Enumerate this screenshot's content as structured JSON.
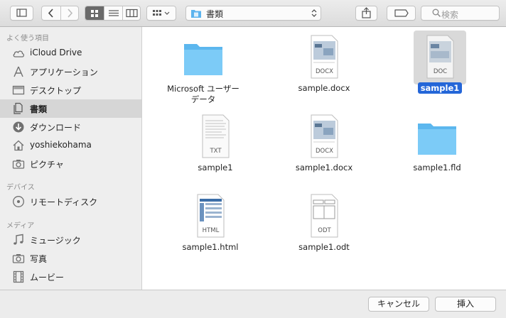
{
  "toolbar": {
    "path_label": "書類",
    "search_placeholder": "検索"
  },
  "sidebar": {
    "sections": [
      {
        "title": "よく使う項目"
      },
      {
        "title": "デバイス"
      },
      {
        "title": "メディア"
      }
    ],
    "items": [
      {
        "label": "iCloud Drive",
        "icon": "cloud-icon"
      },
      {
        "label": "アプリケーション",
        "icon": "applications-icon"
      },
      {
        "label": "デスクトップ",
        "icon": "desktop-icon"
      },
      {
        "label": "書類",
        "icon": "documents-icon",
        "active": true
      },
      {
        "label": "ダウンロード",
        "icon": "download-icon"
      },
      {
        "label": "yoshiekohama",
        "icon": "home-icon"
      },
      {
        "label": "ピクチャ",
        "icon": "camera-icon"
      },
      {
        "label": "リモートディスク",
        "icon": "disc-icon"
      },
      {
        "label": "ミュージック",
        "icon": "music-icon"
      },
      {
        "label": "写真",
        "icon": "camera-icon"
      },
      {
        "label": "ムービー",
        "icon": "film-icon"
      }
    ]
  },
  "files": [
    {
      "name": "Microsoft ユーザー\nデータ",
      "kind": "folder"
    },
    {
      "name": "sample.docx",
      "kind": "document",
      "badge": "DOCX"
    },
    {
      "name": "sample1",
      "kind": "document",
      "badge": "DOC",
      "selected": true
    },
    {
      "name": "sample1",
      "kind": "document",
      "badge": "TXT"
    },
    {
      "name": "sample1.docx",
      "kind": "document",
      "badge": "DOCX"
    },
    {
      "name": "sample1.fld",
      "kind": "folder"
    },
    {
      "name": "sample1.html",
      "kind": "document",
      "badge": "HTML"
    },
    {
      "name": "sample1.odt",
      "kind": "document",
      "badge": "ODT"
    }
  ],
  "buttons": {
    "cancel": "キャンセル",
    "insert": "挿入"
  },
  "colors": {
    "selection": "#2466d8",
    "folder": "#6cc3f5"
  }
}
